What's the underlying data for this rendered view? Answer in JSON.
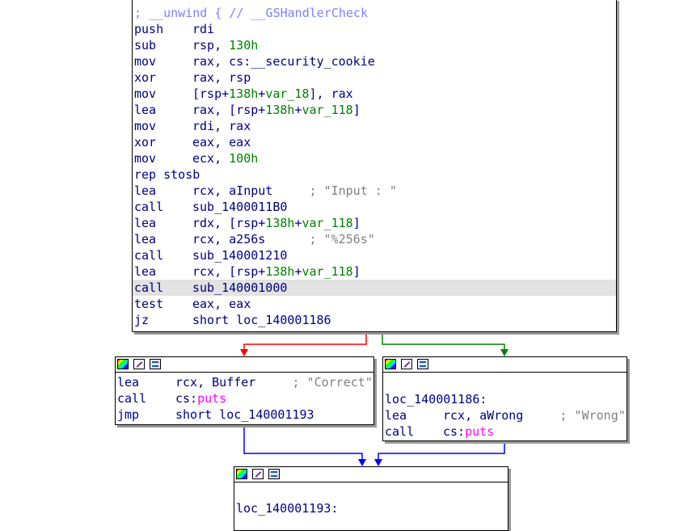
{
  "colors": {
    "edge_false": "#ff0000",
    "edge_true": "#008000",
    "edge_unconditional": "#0000ff",
    "mnemonic": "#000080",
    "number": "#008000",
    "import": "#ff00ff",
    "comment": "#808080",
    "highlight_row": "#e2e2e2"
  },
  "header_icons": [
    "color-palette-icon",
    "rename-pencil-icon",
    "graph-overview-icon"
  ],
  "main_block": {
    "lines": [
      {
        "mnemonic": "; __unwind { // __GSHandlerCheck",
        "operands": "",
        "comment": ""
      },
      {
        "mnemonic": "push",
        "operands": "rdi",
        "comment": ""
      },
      {
        "mnemonic": "sub",
        "operands": "rsp, ",
        "num": "130h",
        "comment": ""
      },
      {
        "mnemonic": "mov",
        "operands": "rax, cs:__security_cookie",
        "comment": ""
      },
      {
        "mnemonic": "xor",
        "operands": "rax, rsp",
        "comment": ""
      },
      {
        "mnemonic": "mov",
        "operands": "[rsp+",
        "num": "138h",
        "sep": "+",
        "var": "var_18",
        "tail": "], rax"
      },
      {
        "mnemonic": "lea",
        "operands": "rax, [rsp+",
        "num": "138h",
        "sep": "+",
        "var": "var_118",
        "tail": "]"
      },
      {
        "mnemonic": "mov",
        "operands": "rdi, rax"
      },
      {
        "mnemonic": "xor",
        "operands": "eax, eax"
      },
      {
        "mnemonic": "mov",
        "operands": "ecx, ",
        "num": "100h"
      },
      {
        "mnemonic": "rep stosb",
        "operands": ""
      },
      {
        "mnemonic": "lea",
        "operands": "rcx, aInput     ",
        "comment": "; \"Input : \""
      },
      {
        "mnemonic": "call",
        "operands": "sub_1400011B0"
      },
      {
        "mnemonic": "lea",
        "operands": "rdx, [rsp+",
        "num": "138h",
        "sep": "+",
        "var": "var_118",
        "tail": "]"
      },
      {
        "mnemonic": "lea",
        "operands": "rcx, a256s      ",
        "comment": "; \"%256s\""
      },
      {
        "mnemonic": "call",
        "operands": "sub_140001210"
      },
      {
        "mnemonic": "lea",
        "operands": "rcx, [rsp+",
        "num": "138h",
        "sep": "+",
        "var": "var_118",
        "tail": "]"
      },
      {
        "mnemonic": "call",
        "operands": "sub_140001000",
        "highlight": true
      },
      {
        "mnemonic": "test",
        "operands": "eax, eax"
      },
      {
        "mnemonic": "jz",
        "operands": "short loc_140001186"
      }
    ]
  },
  "left_block": {
    "lines": [
      {
        "mnemonic": "lea",
        "operands": "rcx, Buffer     ",
        "comment": "; \"Correct\""
      },
      {
        "mnemonic": "call",
        "operands": "cs:",
        "ext": "puts"
      },
      {
        "mnemonic": "jmp",
        "operands": "short loc_140001193"
      }
    ]
  },
  "right_block": {
    "label": "loc_140001186:",
    "lines": [
      {
        "mnemonic": "lea",
        "operands": "rcx, aWrong     ",
        "comment": "; \"Wrong\""
      },
      {
        "mnemonic": "call",
        "operands": "cs:",
        "ext": "puts"
      }
    ]
  },
  "bottom_block": {
    "label": "loc_140001193:"
  }
}
